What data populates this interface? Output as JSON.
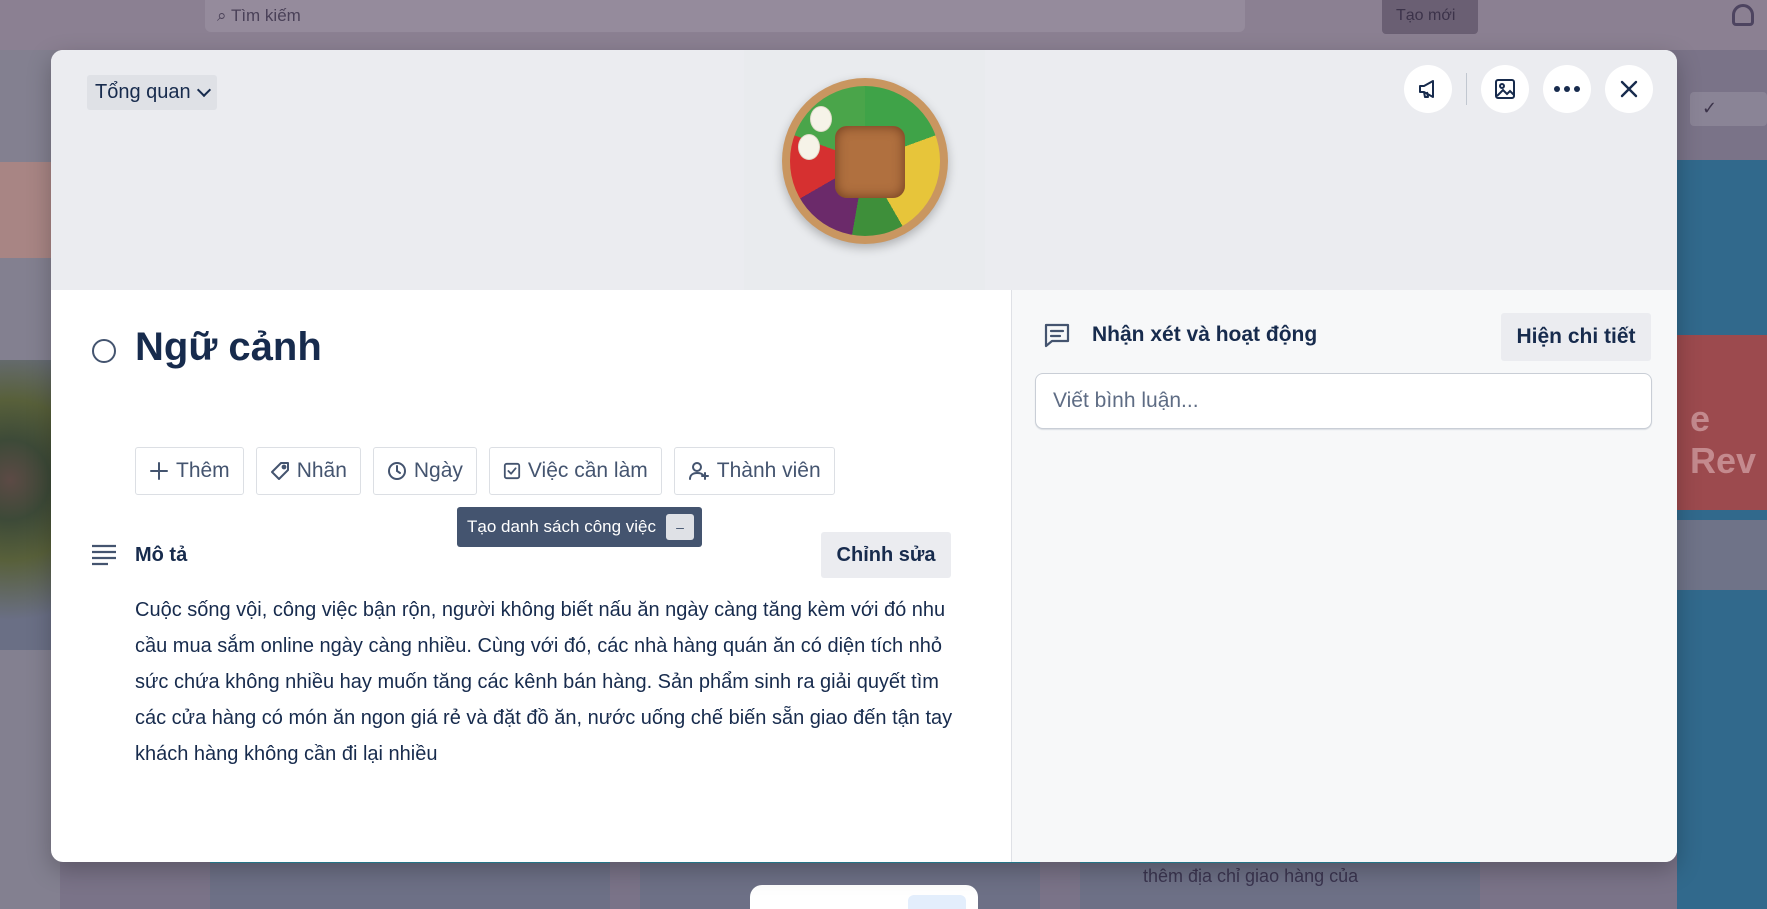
{
  "background": {
    "search_placeholder": "Tìm kiếm",
    "create_button": "Tạo mới",
    "bottom_card_text": "thêm địa chỉ giao hàng của",
    "right_card_text": "e Rev"
  },
  "modal": {
    "view_dropdown_label": "Tổng quan",
    "cover_actions": {
      "announce_icon": "megaphone-icon",
      "cover_icon": "image-icon",
      "more_icon": "more-horizontal-icon",
      "close_icon": "close-icon"
    },
    "title": "Ngữ cảnh",
    "actions": [
      {
        "icon": "plus-icon",
        "label": "Thêm"
      },
      {
        "icon": "tag-icon",
        "label": "Nhãn"
      },
      {
        "icon": "clock-icon",
        "label": "Ngày"
      },
      {
        "icon": "checkbox-icon",
        "label": "Việc cần làm"
      },
      {
        "icon": "user-add-icon",
        "label": "Thành viên"
      }
    ],
    "tooltip": {
      "text": "Tạo danh sách công việc",
      "shortcut": "–"
    },
    "description": {
      "label": "Mô tả",
      "edit_button": "Chỉnh sửa",
      "text": "Cuộc sống vội, công việc bận rộn, người không biết nấu ăn ngày càng tăng kèm với đó nhu cầu mua sắm online ngày càng nhiều. Cùng với đó, các nhà hàng quán ăn có diện tích nhỏ sức chứa không nhiều hay muốn tăng các kênh bán hàng. Sản phẩm sinh ra giải quyết tìm các cửa hàng có món ăn ngon giá rẻ và đặt đồ ăn, nước uống chế biến sẵn giao đến tận tay khách hàng không cần đi lại nhiều"
    },
    "comments": {
      "label": "Nhận xét và hoạt động",
      "details_button": "Hiện chi tiết",
      "input_placeholder": "Viết bình luận..."
    }
  }
}
